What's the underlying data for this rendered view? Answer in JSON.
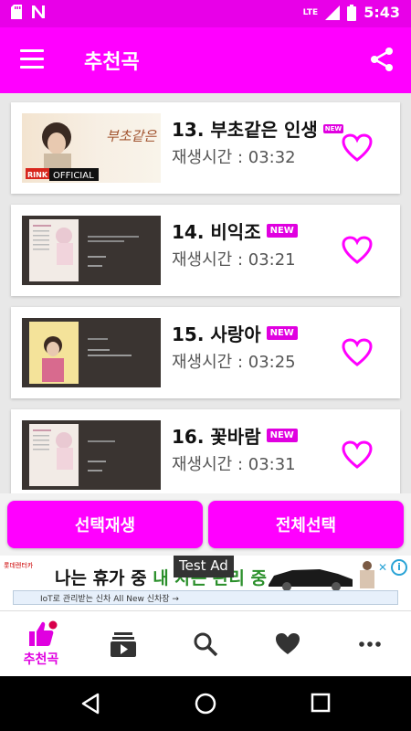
{
  "status_bar": {
    "time": "5:43",
    "network": "LTE"
  },
  "app_bar": {
    "title": "추천곡"
  },
  "songs": [
    {
      "title": "13. 부초같은 인생",
      "duration": "재생시간 : 03:32",
      "badge": "NEW",
      "thumb_caption": "OFFICIAL",
      "thumb_text": "부초같은 인생",
      "thumb_brand": "RINK"
    },
    {
      "title": "14. 비익조",
      "duration": "재생시간 : 03:21",
      "badge": "NEW"
    },
    {
      "title": "15. 사랑아",
      "duration": "재생시간 : 03:25",
      "badge": "NEW"
    },
    {
      "title": "16. 꽃바람",
      "duration": "재생시간 : 03:31",
      "badge": "NEW"
    }
  ],
  "actions": {
    "play_selected": "선택재생",
    "select_all": "전체선택"
  },
  "ad": {
    "label": "Test Ad",
    "brand": "롯데렌터카",
    "headline": "나는 휴가 중",
    "headline_accent": "내 차는 관리 중",
    "subline": "IoT로 관리받는 신차 All New 신차장 →"
  },
  "bottom_nav": {
    "active_label": "추천곡",
    "items": [
      "recommend",
      "playlist",
      "search",
      "favorites",
      "more"
    ]
  },
  "colors": {
    "primary": "#ff00ff",
    "status": "#e800e8",
    "heart": "#ff00ff"
  }
}
